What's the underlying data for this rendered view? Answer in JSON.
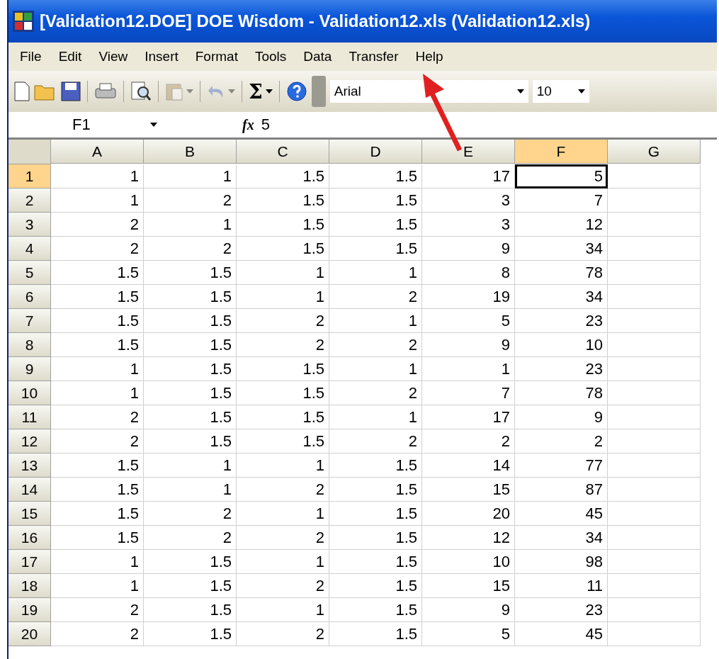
{
  "window": {
    "title": "[Validation12.DOE] DOE Wisdom - Validation12.xls (Validation12.xls)"
  },
  "menu": [
    "File",
    "Edit",
    "View",
    "Insert",
    "Format",
    "Tools",
    "Data",
    "Transfer",
    "Help"
  ],
  "toolbar": {
    "items": [
      {
        "kind": "new",
        "disabled": false,
        "dropdown": false
      },
      {
        "kind": "open",
        "disabled": false,
        "dropdown": false
      },
      {
        "kind": "save",
        "disabled": false,
        "dropdown": false
      },
      {
        "kind": "sep"
      },
      {
        "kind": "print",
        "disabled": false,
        "dropdown": false
      },
      {
        "kind": "sep"
      },
      {
        "kind": "preview",
        "disabled": false,
        "dropdown": false
      },
      {
        "kind": "sep"
      },
      {
        "kind": "paste",
        "disabled": true,
        "dropdown": true
      },
      {
        "kind": "sep"
      },
      {
        "kind": "undo",
        "disabled": true,
        "dropdown": true
      },
      {
        "kind": "sep"
      },
      {
        "kind": "sum",
        "label": "Σ",
        "disabled": false,
        "dropdown": true
      },
      {
        "kind": "sep"
      },
      {
        "kind": "help",
        "disabled": false,
        "dropdown": false
      }
    ],
    "font": "Arial",
    "size": "10"
  },
  "formula_bar": {
    "name_box": "F1",
    "fx": "fx",
    "value": "5"
  },
  "columns": [
    {
      "label": "A",
      "selected": false
    },
    {
      "label": "B",
      "selected": false
    },
    {
      "label": "C",
      "selected": false
    },
    {
      "label": "D",
      "selected": false
    },
    {
      "label": "E",
      "selected": false
    },
    {
      "label": "F",
      "selected": true
    },
    {
      "label": "G",
      "selected": false
    }
  ],
  "rows": [
    {
      "label": "1",
      "selected": true,
      "cells": [
        "1",
        "1",
        "1.5",
        "1.5",
        "17",
        "5"
      ]
    },
    {
      "label": "2",
      "selected": false,
      "cells": [
        "1",
        "2",
        "1.5",
        "1.5",
        "3",
        "7"
      ]
    },
    {
      "label": "3",
      "selected": false,
      "cells": [
        "2",
        "1",
        "1.5",
        "1.5",
        "3",
        "12"
      ]
    },
    {
      "label": "4",
      "selected": false,
      "cells": [
        "2",
        "2",
        "1.5",
        "1.5",
        "9",
        "34"
      ]
    },
    {
      "label": "5",
      "selected": false,
      "cells": [
        "1.5",
        "1.5",
        "1",
        "1",
        "8",
        "78"
      ]
    },
    {
      "label": "6",
      "selected": false,
      "cells": [
        "1.5",
        "1.5",
        "1",
        "2",
        "19",
        "34"
      ]
    },
    {
      "label": "7",
      "selected": false,
      "cells": [
        "1.5",
        "1.5",
        "2",
        "1",
        "5",
        "23"
      ]
    },
    {
      "label": "8",
      "selected": false,
      "cells": [
        "1.5",
        "1.5",
        "2",
        "2",
        "9",
        "10"
      ]
    },
    {
      "label": "9",
      "selected": false,
      "cells": [
        "1",
        "1.5",
        "1.5",
        "1",
        "1",
        "23"
      ]
    },
    {
      "label": "10",
      "selected": false,
      "cells": [
        "1",
        "1.5",
        "1.5",
        "2",
        "7",
        "78"
      ]
    },
    {
      "label": "11",
      "selected": false,
      "cells": [
        "2",
        "1.5",
        "1.5",
        "1",
        "17",
        "9"
      ]
    },
    {
      "label": "12",
      "selected": false,
      "cells": [
        "2",
        "1.5",
        "1.5",
        "2",
        "2",
        "2"
      ]
    },
    {
      "label": "13",
      "selected": false,
      "cells": [
        "1.5",
        "1",
        "1",
        "1.5",
        "14",
        "77"
      ]
    },
    {
      "label": "14",
      "selected": false,
      "cells": [
        "1.5",
        "1",
        "2",
        "1.5",
        "15",
        "87"
      ]
    },
    {
      "label": "15",
      "selected": false,
      "cells": [
        "1.5",
        "2",
        "1",
        "1.5",
        "20",
        "45"
      ]
    },
    {
      "label": "16",
      "selected": false,
      "cells": [
        "1.5",
        "2",
        "2",
        "1.5",
        "12",
        "34"
      ]
    },
    {
      "label": "17",
      "selected": false,
      "cells": [
        "1",
        "1.5",
        "1",
        "1.5",
        "10",
        "98"
      ]
    },
    {
      "label": "18",
      "selected": false,
      "cells": [
        "1",
        "1.5",
        "2",
        "1.5",
        "15",
        "11"
      ]
    },
    {
      "label": "19",
      "selected": false,
      "cells": [
        "2",
        "1.5",
        "1",
        "1.5",
        "9",
        "23"
      ]
    },
    {
      "label": "20",
      "selected": false,
      "cells": [
        "2",
        "1.5",
        "2",
        "1.5",
        "5",
        "45"
      ]
    }
  ]
}
